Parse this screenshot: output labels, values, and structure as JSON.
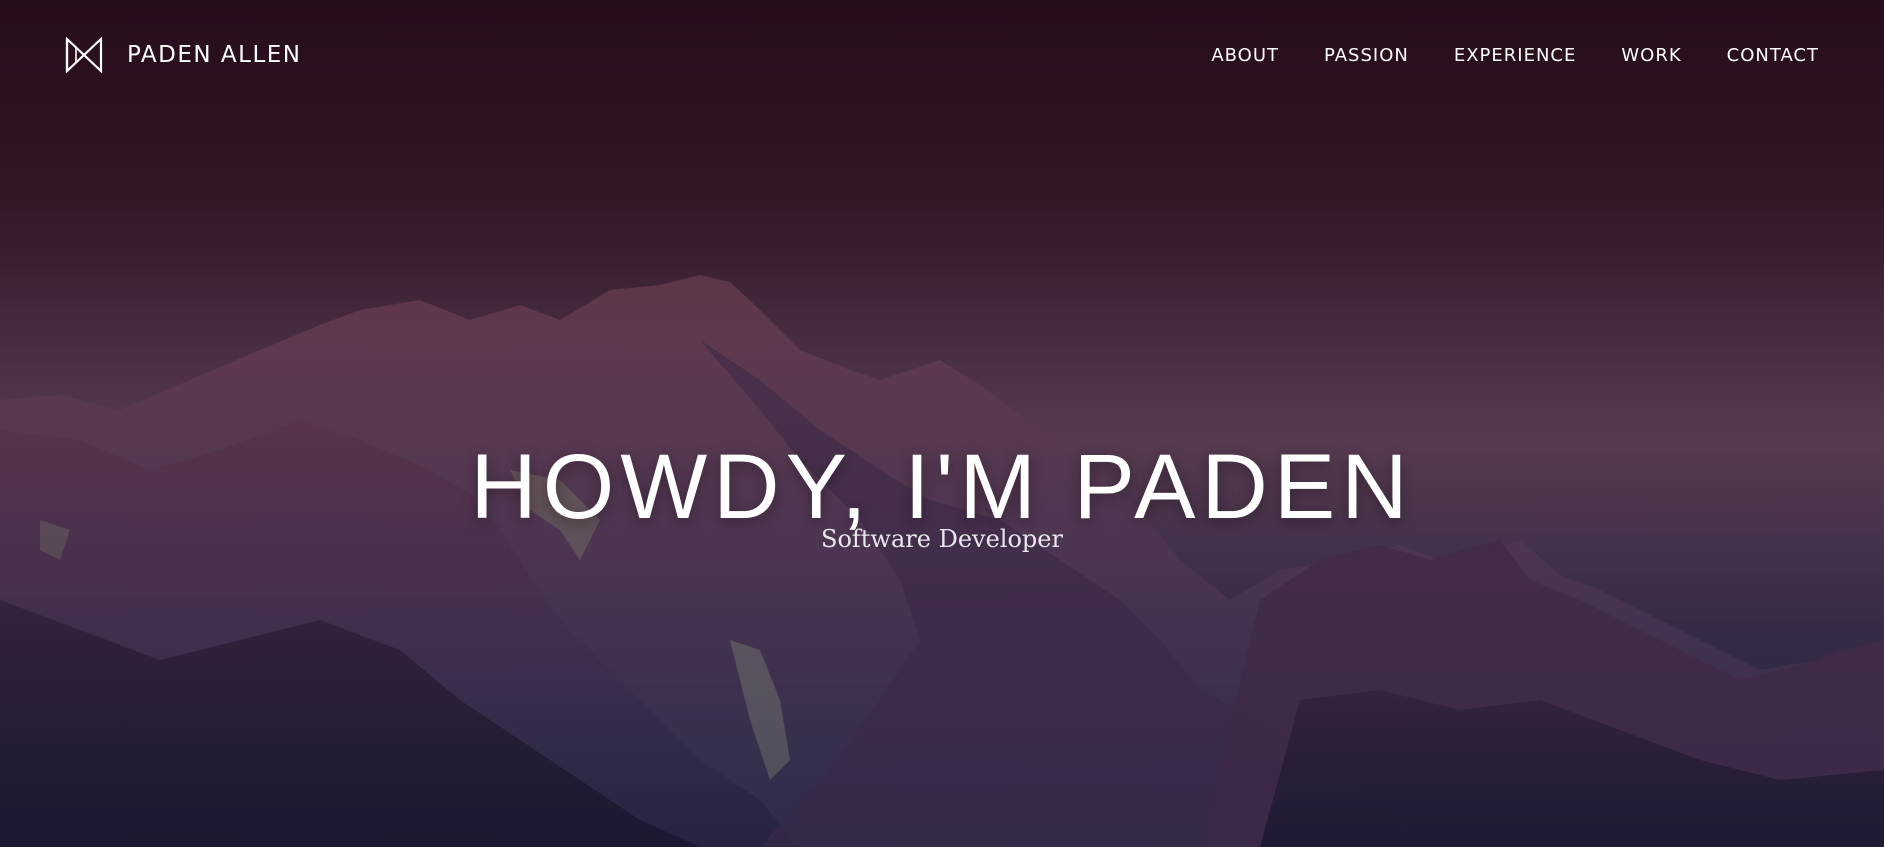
{
  "brand": {
    "logo_icon": "bowtie-hourglass-icon",
    "name": "PADEN ALLEN"
  },
  "nav": {
    "items": [
      {
        "label": "ABOUT"
      },
      {
        "label": "PASSION"
      },
      {
        "label": "EXPERIENCE"
      },
      {
        "label": "WORK"
      },
      {
        "label": "CONTACT"
      }
    ]
  },
  "hero": {
    "headline": "HOWDY, I'M PADEN",
    "subtitle": "Software Developer",
    "background": "mountain-range-photo"
  },
  "colors": {
    "text": "#ffffff",
    "sky_top": "#2c1220",
    "sky_mid": "#6a4a5e",
    "mountain_shadow": "#2a2a44"
  }
}
